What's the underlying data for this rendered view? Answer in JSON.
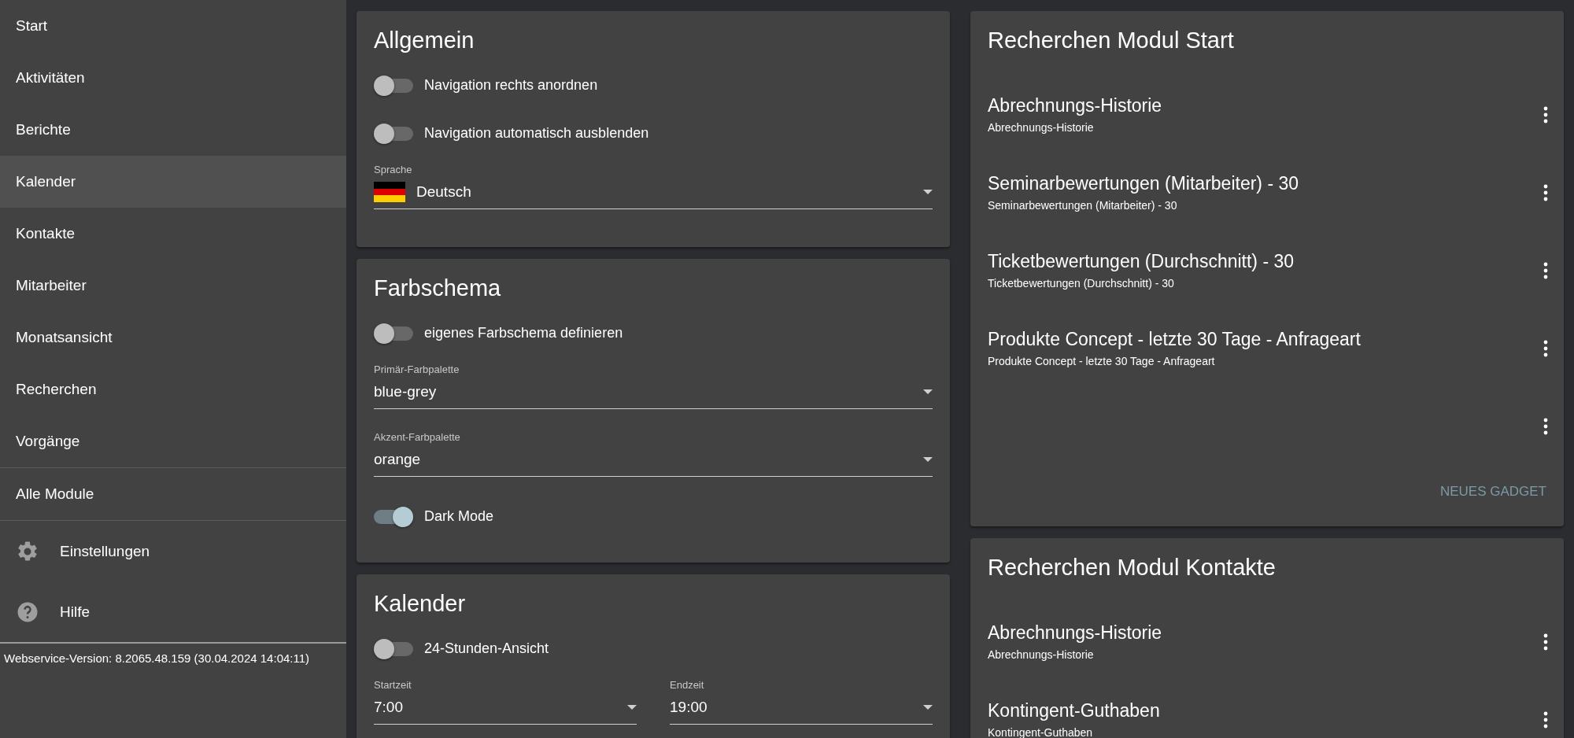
{
  "sidebar": {
    "items": [
      {
        "label": "Start",
        "selected": false
      },
      {
        "label": "Aktivitäten",
        "selected": false
      },
      {
        "label": "Berichte",
        "selected": false
      },
      {
        "label": "Kalender",
        "selected": true
      },
      {
        "label": "Kontakte",
        "selected": false
      },
      {
        "label": "Mitarbeiter",
        "selected": false
      },
      {
        "label": "Monatsansicht",
        "selected": false
      },
      {
        "label": "Recherchen",
        "selected": false
      },
      {
        "label": "Vorgänge",
        "selected": false
      }
    ],
    "all_modules": "Alle Module",
    "footer_items": [
      {
        "label": "Einstellungen",
        "kind": "settings"
      },
      {
        "label": "Hilfe",
        "kind": "help"
      }
    ],
    "version": "Webservice-Version: 8.2065.48.159 (30.04.2024 14:04:11)"
  },
  "settings_cards": [
    {
      "title": "Allgemein",
      "fields": [
        {
          "kind": "toggle",
          "label": "Navigation rechts anordnen",
          "on": false
        },
        {
          "kind": "toggle",
          "label": "Navigation automatisch ausblenden",
          "on": false
        },
        {
          "kind": "select",
          "label": "Sprache",
          "value": "Deutsch",
          "has_flag": true
        }
      ]
    },
    {
      "title": "Farbschema",
      "fields": [
        {
          "kind": "toggle",
          "label": "eigenes Farbschema definieren",
          "on": false
        },
        {
          "kind": "select",
          "label": "Primär-Farbpalette",
          "value": "blue-grey"
        },
        {
          "kind": "select",
          "label": "Akzent-Farbpalette",
          "value": "orange"
        },
        {
          "kind": "toggle",
          "label": "Dark Mode",
          "on": true
        }
      ]
    },
    {
      "title": "Kalender",
      "fields": [
        {
          "kind": "toggle",
          "label": "24-Stunden-Ansicht",
          "on": false
        },
        {
          "kind": "select_pair",
          "items": [
            {
              "label": "Startzeit",
              "value": "7:00"
            },
            {
              "label": "Endzeit",
              "value": "19:00"
            }
          ]
        }
      ]
    }
  ],
  "module_cards": [
    {
      "title": "Recherchen Modul Start",
      "items": [
        {
          "kind": "gadget",
          "title": "Abrechnungs-Historie",
          "subtitle": "Abrechnungs-Historie"
        },
        {
          "kind": "gadget",
          "title": "Seminarbewertungen (Mitarbeiter) - 30",
          "subtitle": "Seminarbewertungen (Mitarbeiter) - 30"
        },
        {
          "kind": "gadget",
          "title": "Ticketbewertungen (Durchschnitt) - 30",
          "subtitle": "Ticketbewertungen (Durchschnitt) - 30"
        },
        {
          "kind": "gadget",
          "title": "Produkte Concept - letzte 30 Tage - Anfrageart",
          "subtitle": "Produkte Concept - letzte 30 Tage - Anfrageart"
        },
        {
          "kind": "empty"
        }
      ],
      "action": "NEUES GADGET"
    },
    {
      "title": "Recherchen Modul Kontakte",
      "items": [
        {
          "kind": "gadget",
          "title": "Abrechnungs-Historie",
          "subtitle": "Abrechnungs-Historie"
        },
        {
          "kind": "gadget",
          "title": "Kontingent-Guthaben",
          "subtitle": "Kontingent-Guthaben"
        }
      ]
    }
  ]
}
